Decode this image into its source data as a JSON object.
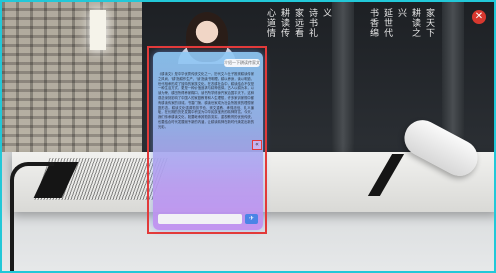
{
  "scene": {
    "calligraphy": [
      "心道情",
      "耕读传",
      "家远看",
      "诗书礼",
      "义",
      "书香绵",
      "延世代",
      "兴",
      "耕读之",
      "家天下"
    ]
  },
  "chat": {
    "user_query": "介绍一下耕读传家文化",
    "answer": "《耕读文》是中华优秀传统文化之一，历代文人仕子推崇耕读传家之风尚，'耕'指耕作生产，'读'指读书明理。耕以养身，读以明道，世代相承形成了独特的家族文化。在农耕社会中，耕读结合不仅是一种生活方式，更是一种价值追求与精神信仰。古人以耕为本，以读为荣，耕田所得养家糊口，读书所学修身齐家治国平天下。这种观念深刻影响了中国人的家庭教育和人生理想，许多家训家规中都有耕读传家的训诫。书香门第、耕读世家成为社会所推崇的理想家庭形态。耕读文化强调勤劳节俭、崇文重教、孝悌忠信、礼义廉耻，在长期的历史发展中积淀为中华民族宝贵的精神财富。今天，我们传承耕读文化，既要继承其勤劳务实、重视教育的优良传统，也要结合时代发展赋予新的内涵，让耕读精神在新时代焕发出新的光彩。",
    "expand_glyph": "«",
    "input_placeholder": "",
    "send_glyph": "✈"
  },
  "window": {
    "close_glyph": "✕"
  },
  "colors": {
    "frame_border": "#22c8d8",
    "highlight": "#e23a3a",
    "send_button": "#4b84e6",
    "close_button": "#d8382f"
  }
}
